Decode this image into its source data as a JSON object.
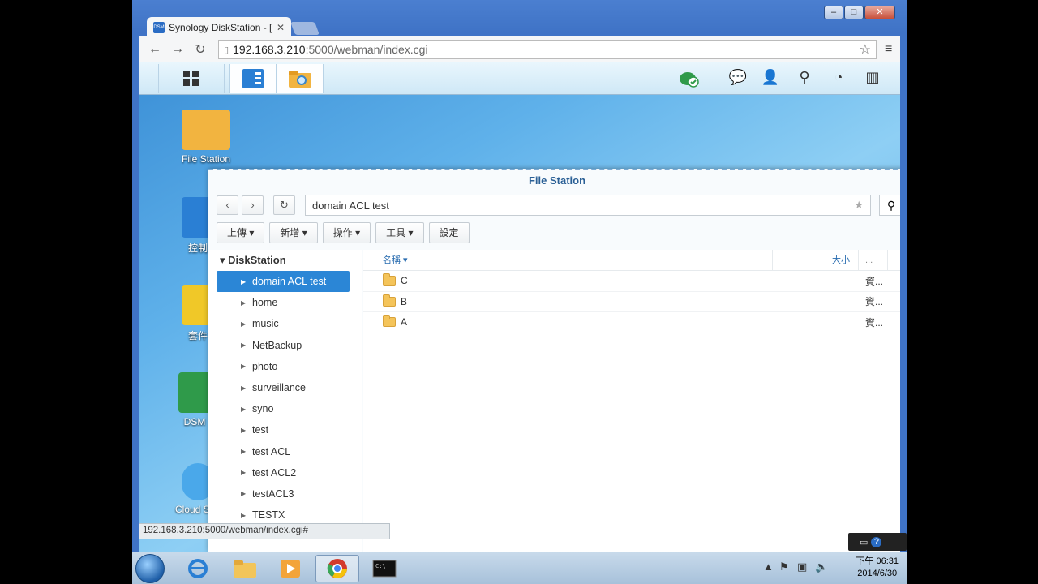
{
  "browser": {
    "tab_title": "Synology DiskStation - [",
    "favicon_text": "DSM",
    "url_host": "192.168.3.210",
    "url_path": ":5000/webman/index.cgi",
    "status_url": "192.168.3.210:5000/webman/index.cgi#"
  },
  "desktop": {
    "icons": [
      {
        "label": "File Station"
      },
      {
        "label": "控制"
      },
      {
        "label": "套件"
      },
      {
        "label": "DSM"
      },
      {
        "label": "Cloud Stat"
      }
    ]
  },
  "file_station": {
    "title": "File Station",
    "path": "domain ACL test",
    "toolbar": {
      "upload": "上傳",
      "create": "新增",
      "action": "操作",
      "tools": "工具",
      "settings": "設定"
    },
    "tree_root": "DiskStation",
    "tree_items": [
      {
        "label": "domain ACL test"
      },
      {
        "label": "home"
      },
      {
        "label": "music"
      },
      {
        "label": "NetBackup"
      },
      {
        "label": "photo"
      },
      {
        "label": "surveillance"
      },
      {
        "label": "syno"
      },
      {
        "label": "test"
      },
      {
        "label": "test ACL"
      },
      {
        "label": "test ACL2"
      },
      {
        "label": "testACL3"
      },
      {
        "label": "TESTX"
      }
    ],
    "columns": {
      "name": "名稱",
      "size": "大小",
      "more": "..."
    },
    "files": [
      {
        "name": "C",
        "type": "資..."
      },
      {
        "name": "B",
        "type": "資..."
      },
      {
        "name": "A",
        "type": "資..."
      }
    ]
  },
  "taskbar": {
    "time": "下午 06:31",
    "date": "2014/6/30"
  },
  "colors": {
    "accent": "#2b86d6",
    "title": "#2a5f95"
  }
}
